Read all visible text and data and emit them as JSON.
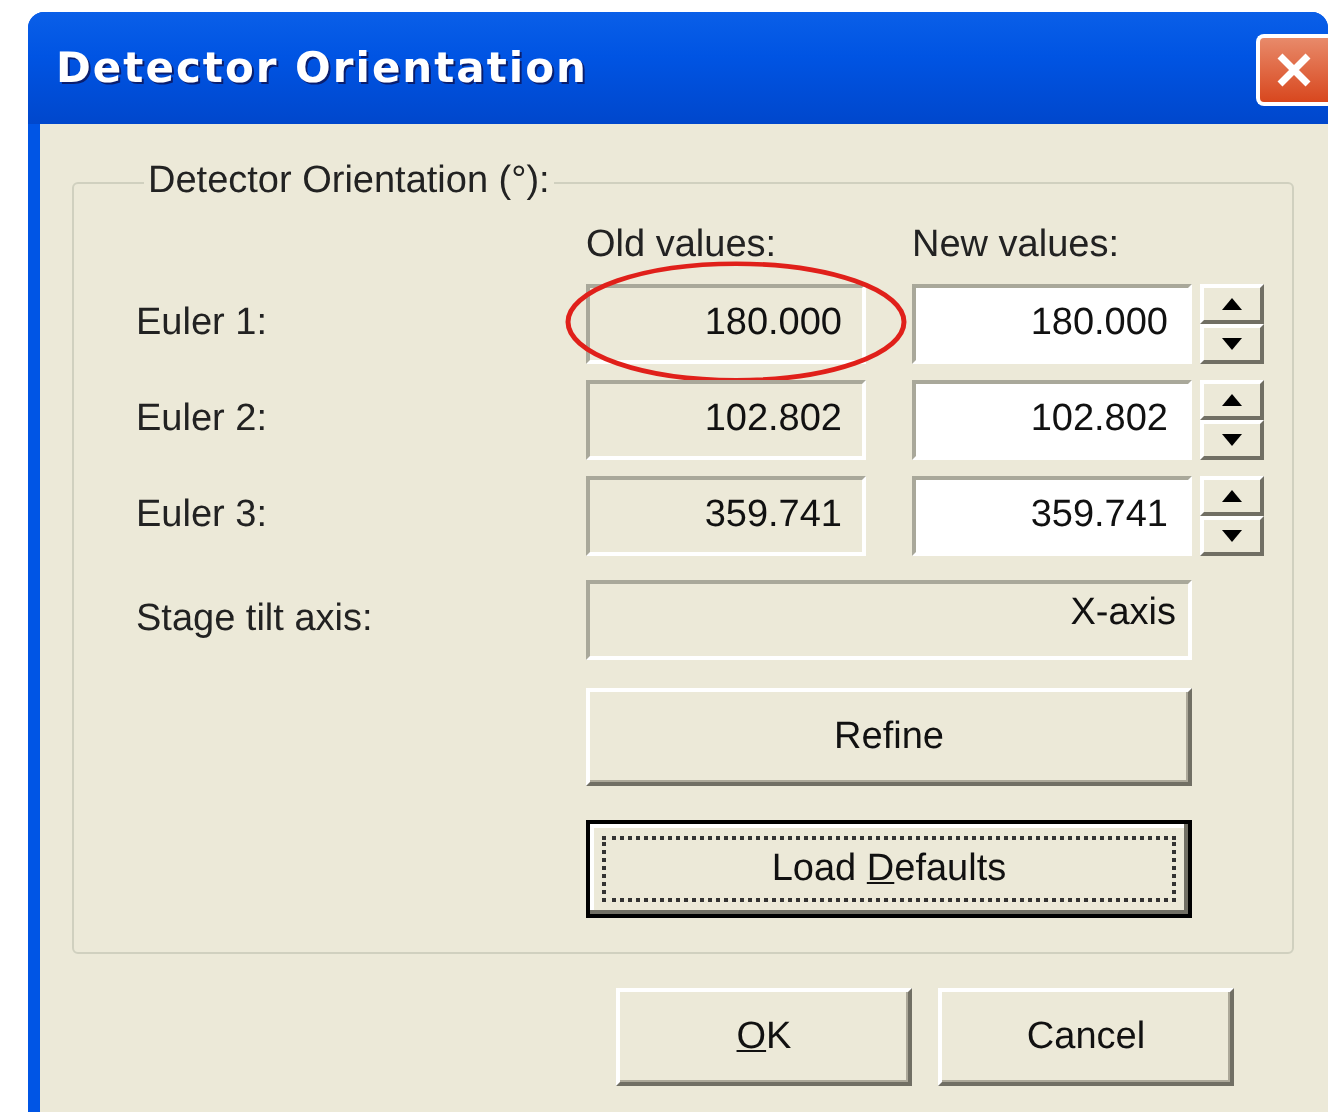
{
  "window": {
    "title": "Detector Orientation"
  },
  "group": {
    "title": "Detector Orientation (°):",
    "columns": [
      "Old values:",
      "New values:"
    ],
    "rows": [
      {
        "label": "Euler 1:",
        "old": "180.000",
        "new": "180.000",
        "circled": true
      },
      {
        "label": "Euler 2:",
        "old": "102.802",
        "new": "102.802",
        "circled": false
      },
      {
        "label": "Euler 3:",
        "old": "359.741",
        "new": "359.741",
        "circled": false
      }
    ],
    "stage_tilt": {
      "label": "Stage tilt axis:",
      "value": "X-axis"
    },
    "buttons": [
      {
        "label": [
          {
            "text": "Refine",
            "underline": false
          }
        ],
        "focused": false
      },
      {
        "label": [
          {
            "text": "Load ",
            "underline": false
          },
          {
            "text": "D",
            "underline": true
          },
          {
            "text": "efaults",
            "underline": false
          }
        ],
        "focused": true
      }
    ]
  },
  "footer_buttons": [
    {
      "label": [
        {
          "text": "O",
          "underline": true
        },
        {
          "text": "K",
          "underline": false
        }
      ],
      "focused": false
    },
    {
      "label": [
        {
          "text": "Cancel",
          "underline": false
        }
      ],
      "focused": false
    }
  ]
}
